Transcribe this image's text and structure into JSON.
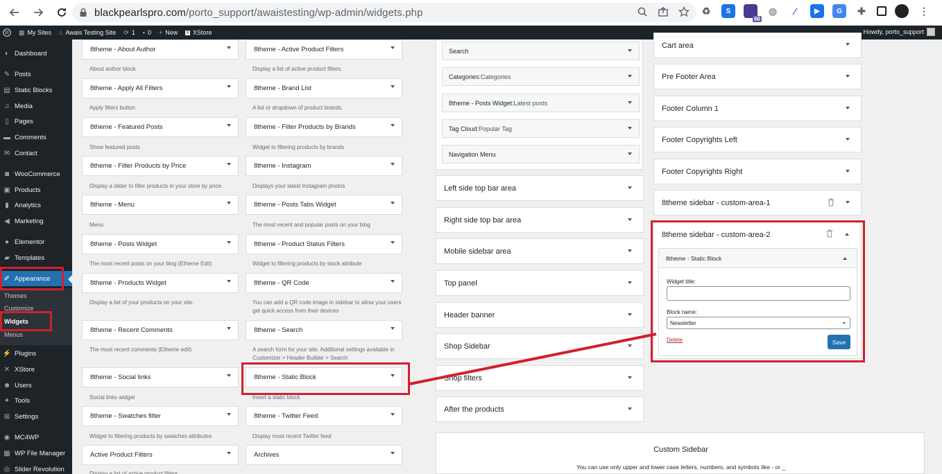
{
  "browser": {
    "url_host": "blackpearlspro.com",
    "url_path": "/porto_support/awaistesting/wp-admin/widgets.php",
    "ext_badge": "66"
  },
  "adminbar": {
    "my_sites": "My Sites",
    "site_name": "Awais Testing Site",
    "updates": "1",
    "comments": "0",
    "new": "New",
    "xstore": "XStore",
    "howdy": "Howdy, porto_support"
  },
  "sidebar": {
    "items": [
      {
        "label": "Dashboard",
        "icon": "dashboard-icon"
      },
      {
        "label": "Posts",
        "icon": "pin-icon"
      },
      {
        "label": "Static Blocks",
        "icon": "blocks-icon"
      },
      {
        "label": "Media",
        "icon": "media-icon"
      },
      {
        "label": "Pages",
        "icon": "pages-icon"
      },
      {
        "label": "Comments",
        "icon": "comments-icon"
      },
      {
        "label": "Contact",
        "icon": "mail-icon"
      },
      {
        "label": "WooCommerce",
        "icon": "woo-icon"
      },
      {
        "label": "Products",
        "icon": "products-icon"
      },
      {
        "label": "Analytics",
        "icon": "analytics-icon"
      },
      {
        "label": "Marketing",
        "icon": "megaphone-icon"
      },
      {
        "label": "Elementor",
        "icon": "elementor-icon"
      },
      {
        "label": "Templates",
        "icon": "folder-icon"
      },
      {
        "label": "Appearance",
        "icon": "brush-icon"
      },
      {
        "label": "Plugins",
        "icon": "plug-icon"
      },
      {
        "label": "XStore",
        "icon": "xstore-icon"
      },
      {
        "label": "Users",
        "icon": "users-icon"
      },
      {
        "label": "Tools",
        "icon": "wrench-icon"
      },
      {
        "label": "Settings",
        "icon": "settings-icon"
      },
      {
        "label": "MC4WP",
        "icon": "mc4wp-icon"
      },
      {
        "label": "WP File Manager",
        "icon": "file-manager-icon"
      },
      {
        "label": "Slider Revolution",
        "icon": "slider-icon"
      }
    ],
    "submenu": [
      "Themes",
      "Customize",
      "Widgets",
      "Menus"
    ]
  },
  "available_widgets": {
    "col1": [
      {
        "title": "8theme - About Author",
        "desc": "About author block"
      },
      {
        "title": "8theme - Apply All Filters",
        "desc": "Apply filters button"
      },
      {
        "title": "8theme - Featured Posts",
        "desc": "Show featured posts"
      },
      {
        "title": "8theme - Filter Products by Price",
        "desc": "Display a slider to filter products in your store by price."
      },
      {
        "title": "8theme - Menu",
        "desc": "Menu"
      },
      {
        "title": "8theme - Posts Widget",
        "desc": "The most recent posts on your blog (Etheme Edit)"
      },
      {
        "title": "8theme - Products Widget",
        "desc": "Display a list of your products on your site."
      },
      {
        "title": "8theme - Recent Comments",
        "desc": "The most recent comments (Etheme edit)"
      },
      {
        "title": "8theme - Social links",
        "desc": "Social links widget"
      },
      {
        "title": "8theme - Swatches filter",
        "desc": "Widget to filtering products by swatches attributes"
      },
      {
        "title": "Active Product Filters",
        "desc": "Display a list of active product filters."
      }
    ],
    "col2": [
      {
        "title": "8theme - Active Product Filters",
        "desc": "Display a list of active product filters."
      },
      {
        "title": "8theme - Brand List",
        "desc": "A list or dropdown of product brands."
      },
      {
        "title": "8theme - Filter Products by Brands",
        "desc": "Widget to filtering products by brands"
      },
      {
        "title": "8theme - Instagram",
        "desc": "Displays your latest Instagram photos"
      },
      {
        "title": "8theme - Posts Tabs Widget",
        "desc": "The most recent and popular posts on your blog"
      },
      {
        "title": "8theme - Product Status Filters",
        "desc": "Widget to filtering products by stock attribute"
      },
      {
        "title": "8theme - QR Code",
        "desc": "You can add a QR code image in sidebar to allow your users get quick access from their devices"
      },
      {
        "title": "8theme - Search",
        "desc": "A search form for your site. Additional settings available in Customizer > Header Builder > Search"
      },
      {
        "title": "8theme - Static Block",
        "desc": "Insert a static block"
      },
      {
        "title": "8theme - Twitter Feed",
        "desc": "Display most recent Twitter feed"
      },
      {
        "title": "Archives",
        "desc": ""
      }
    ]
  },
  "sidebar_widgets": [
    {
      "name": "Search",
      "sub": ""
    },
    {
      "name": "Categories:",
      "sub": " Categories"
    },
    {
      "name": "8theme - Posts Widget:",
      "sub": " Latest posts"
    },
    {
      "name": "Tag Cloud:",
      "sub": " Popular Tag"
    },
    {
      "name": "Navigation Menu",
      "sub": ""
    }
  ],
  "sidebar_areas_mid": [
    "Left side top bar area",
    "Right side top bar area",
    "Mobile sidebar area",
    "Top panel",
    "Header banner",
    "Shop Sidebar",
    "Shop filters",
    "After the products"
  ],
  "sidebar_areas_right": [
    "Cart area",
    "Pre Footer Area",
    "Footer Column 1",
    "Footer Copyrights Left",
    "Footer Copyrights Right",
    "8theme sidebar - custom-area-1",
    "8theme sidebar - custom-area-2"
  ],
  "expanded_widget": {
    "title": "8theme - Static Block",
    "widget_title_label": "Widget title:",
    "widget_title_value": "",
    "block_name_label": "Block name:",
    "block_name_value": "Newsletter",
    "delete": "Delete",
    "save": "Save"
  },
  "custom_sidebar": {
    "title": "Custom Sidebar",
    "subtitle": "You can use only upper and lower case letters, numbers, and symbols like - or _"
  },
  "colors": {
    "accent": "#2271b1",
    "highlight": "#d0202f",
    "admin_dark": "#1d2327"
  }
}
